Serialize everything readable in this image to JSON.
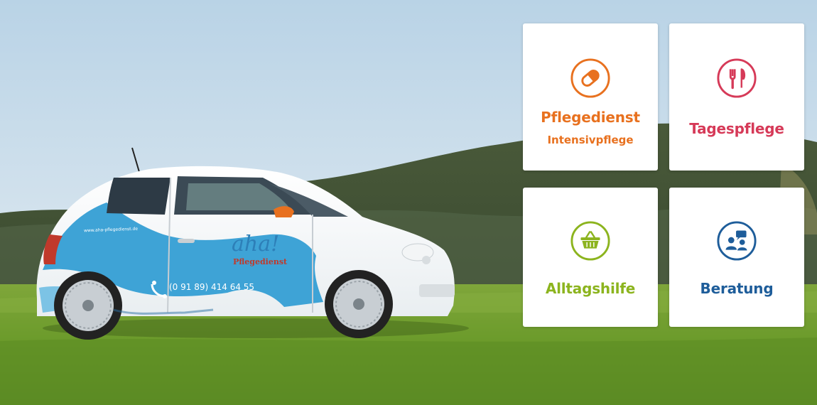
{
  "colors": {
    "orange": "#E8711F",
    "red": "#D63A58",
    "green": "#8CB41E",
    "blue": "#1E5D9A",
    "car_blue": "#3EA3D6"
  },
  "car": {
    "brand": "aha!",
    "brand_sub": "Pflegedienst",
    "phone": "(0 91 89) 414 64 55",
    "website": "www.aha-pflegedienst.de"
  },
  "tiles": [
    {
      "title": "Pflegedienst",
      "subtitle": "Intensivpflege",
      "icon": "pill-icon"
    },
    {
      "title": "Tagespflege",
      "icon": "fork-knife-icon"
    },
    {
      "title": "Alltagshilfe",
      "icon": "basket-icon"
    },
    {
      "title": "Beratung",
      "icon": "conversation-icon"
    }
  ]
}
